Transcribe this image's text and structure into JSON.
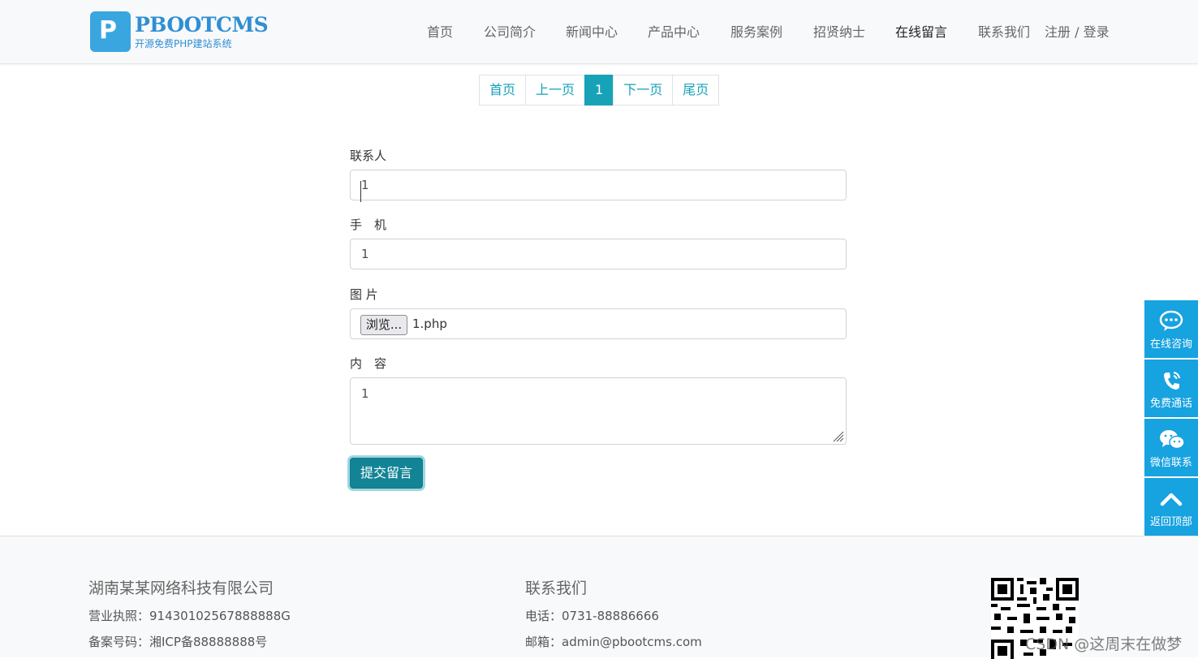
{
  "header": {
    "logo_title": "PBOOTCMS",
    "logo_subtitle": "开源免费PHP建站系统",
    "nav": [
      "首页",
      "公司简介",
      "新闻中心",
      "产品中心",
      "服务案例",
      "招贤纳士",
      "在线留言",
      "联系我们"
    ],
    "active_nav": "在线留言",
    "auth": "注册 / 登录"
  },
  "pagination": {
    "first": "首页",
    "prev": "上一页",
    "current": "1",
    "next": "下一页",
    "last": "尾页"
  },
  "form": {
    "contact_label": "联系人",
    "contact_value": "1",
    "phone_label": "手　机",
    "phone_value": "1",
    "image_label": "图 片",
    "file_button": "浏览...",
    "file_name": "1.php",
    "content_label": "内　容",
    "content_value": "1",
    "submit_label": "提交留言"
  },
  "footer": {
    "company": "湖南某某网络科技有限公司",
    "license": "营业执照：91430102567888888G",
    "icp": "备案号码：湘ICP备88888888号",
    "contact_title": "联系我们",
    "phone": "电话：0731-88886666",
    "email": "邮箱：admin@pbootcms.com"
  },
  "sidebar": {
    "items": [
      "在线咨询",
      "免费通话",
      "微信联系",
      "返回顶部"
    ]
  },
  "watermark": "CSDN @这周末在做梦",
  "colors": {
    "accent": "#17a2b8",
    "sidebar": "#17a2e0",
    "submit": "#138496"
  }
}
